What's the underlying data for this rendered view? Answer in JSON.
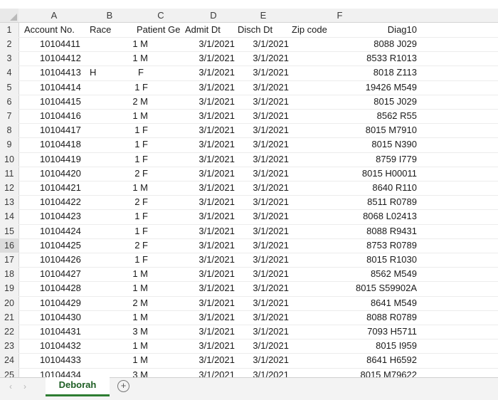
{
  "columns": [
    "A",
    "B",
    "C",
    "D",
    "E",
    "F"
  ],
  "header_row": {
    "row_num": "1",
    "account": "Account No.",
    "race": "Race",
    "patient_gender": "Patient Ge",
    "admit": "Admit Dt",
    "disch": "Disch Dt",
    "zip": "Zip code",
    "diag": "Diag10"
  },
  "rows": [
    {
      "n": "2",
      "account": "10104411",
      "race": "",
      "pg": "1 M",
      "admit": "3/1/2021",
      "disch": "3/1/2021",
      "diag": "8088 J029"
    },
    {
      "n": "3",
      "account": "10104412",
      "race": "",
      "pg": "1 M",
      "admit": "3/1/2021",
      "disch": "3/1/2021",
      "diag": "8533 R1013"
    },
    {
      "n": "4",
      "account": "10104413",
      "race": "H",
      "pg": "F",
      "admit": "3/1/2021",
      "disch": "3/1/2021",
      "diag": "8018 Z113"
    },
    {
      "n": "5",
      "account": "10104414",
      "race": "",
      "pg": "1 F",
      "admit": "3/1/2021",
      "disch": "3/1/2021",
      "diag": "19426 M549"
    },
    {
      "n": "6",
      "account": "10104415",
      "race": "",
      "pg": "2 M",
      "admit": "3/1/2021",
      "disch": "3/1/2021",
      "diag": "8015 J029"
    },
    {
      "n": "7",
      "account": "10104416",
      "race": "",
      "pg": "1 M",
      "admit": "3/1/2021",
      "disch": "3/1/2021",
      "diag": "8562 R55"
    },
    {
      "n": "8",
      "account": "10104417",
      "race": "",
      "pg": "1 F",
      "admit": "3/1/2021",
      "disch": "3/1/2021",
      "diag": "8015 M7910"
    },
    {
      "n": "9",
      "account": "10104418",
      "race": "",
      "pg": "1 F",
      "admit": "3/1/2021",
      "disch": "3/1/2021",
      "diag": "8015 N390"
    },
    {
      "n": "10",
      "account": "10104419",
      "race": "",
      "pg": "1 F",
      "admit": "3/1/2021",
      "disch": "3/1/2021",
      "diag": "8759 I779"
    },
    {
      "n": "11",
      "account": "10104420",
      "race": "",
      "pg": "2 F",
      "admit": "3/1/2021",
      "disch": "3/1/2021",
      "diag": "8015 H00011"
    },
    {
      "n": "12",
      "account": "10104421",
      "race": "",
      "pg": "1 M",
      "admit": "3/1/2021",
      "disch": "3/1/2021",
      "diag": "8640 R110"
    },
    {
      "n": "13",
      "account": "10104422",
      "race": "",
      "pg": "2 F",
      "admit": "3/1/2021",
      "disch": "3/1/2021",
      "diag": "8511 R0789"
    },
    {
      "n": "14",
      "account": "10104423",
      "race": "",
      "pg": "1 F",
      "admit": "3/1/2021",
      "disch": "3/1/2021",
      "diag": "8068 L02413"
    },
    {
      "n": "15",
      "account": "10104424",
      "race": "",
      "pg": "1 F",
      "admit": "3/1/2021",
      "disch": "3/1/2021",
      "diag": "8088 R9431"
    },
    {
      "n": "16",
      "account": "10104425",
      "race": "",
      "pg": "2 F",
      "admit": "3/1/2021",
      "disch": "3/1/2021",
      "diag": "8753 R0789"
    },
    {
      "n": "17",
      "account": "10104426",
      "race": "",
      "pg": "1 F",
      "admit": "3/1/2021",
      "disch": "3/1/2021",
      "diag": "8015 R1030"
    },
    {
      "n": "18",
      "account": "10104427",
      "race": "",
      "pg": "1 M",
      "admit": "3/1/2021",
      "disch": "3/1/2021",
      "diag": "8562 M549"
    },
    {
      "n": "19",
      "account": "10104428",
      "race": "",
      "pg": "1 M",
      "admit": "3/1/2021",
      "disch": "3/1/2021",
      "diag": "8015 S59902A"
    },
    {
      "n": "20",
      "account": "10104429",
      "race": "",
      "pg": "2 M",
      "admit": "3/1/2021",
      "disch": "3/1/2021",
      "diag": "8641 M549"
    },
    {
      "n": "21",
      "account": "10104430",
      "race": "",
      "pg": "1 M",
      "admit": "3/1/2021",
      "disch": "3/1/2021",
      "diag": "8088 R0789"
    },
    {
      "n": "22",
      "account": "10104431",
      "race": "",
      "pg": "3 M",
      "admit": "3/1/2021",
      "disch": "3/1/2021",
      "diag": "7093 H5711"
    },
    {
      "n": "23",
      "account": "10104432",
      "race": "",
      "pg": "1 M",
      "admit": "3/1/2021",
      "disch": "3/1/2021",
      "diag": "8015 I959"
    },
    {
      "n": "24",
      "account": "10104433",
      "race": "",
      "pg": "1 M",
      "admit": "3/1/2021",
      "disch": "3/1/2021",
      "diag": "8641 H6592"
    },
    {
      "n": "25",
      "account": "10104434",
      "race": "",
      "pg": "3 M",
      "admit": "3/1/2021",
      "disch": "3/1/2021",
      "diag": "8015 M79622"
    }
  ],
  "selected_row": "16",
  "sheet_tab": "Deborah",
  "nav_prev_icon": "‹",
  "nav_next_icon": "›",
  "add_sheet_icon": "+",
  "accent_color": "#2e7d32"
}
